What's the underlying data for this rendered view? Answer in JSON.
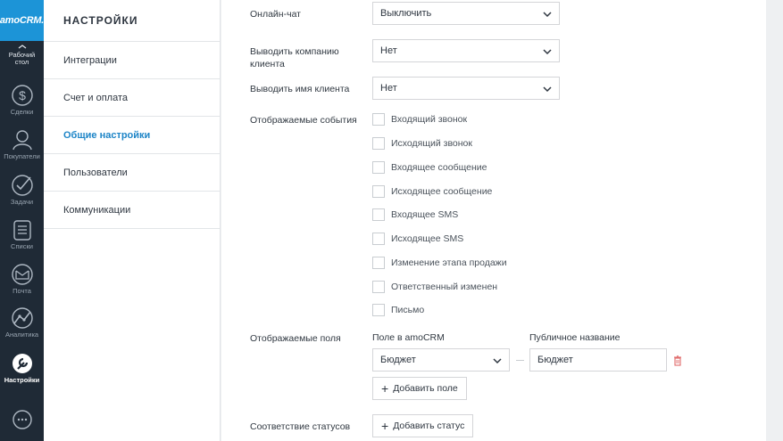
{
  "rail": {
    "logo": "amoCRM.",
    "items": [
      {
        "label": "Рабочий стол",
        "icon": "dashboard-icon"
      },
      {
        "label": "Сделки",
        "icon": "deals-icon"
      },
      {
        "label": "Покупатели",
        "icon": "customers-icon"
      },
      {
        "label": "Задачи",
        "icon": "tasks-icon"
      },
      {
        "label": "Списки",
        "icon": "lists-icon"
      },
      {
        "label": "Почта",
        "icon": "mail-icon"
      },
      {
        "label": "Аналитика",
        "icon": "analytics-icon"
      },
      {
        "label": "Настройки",
        "icon": "settings-icon"
      },
      {
        "label": "",
        "icon": "chat-icon"
      }
    ]
  },
  "sidebar": {
    "title": "НАСТРОЙКИ",
    "items": [
      {
        "label": "Интеграции"
      },
      {
        "label": "Счет и оплата"
      },
      {
        "label": "Общие настройки"
      },
      {
        "label": "Пользователи"
      },
      {
        "label": "Коммуникации"
      }
    ]
  },
  "main": {
    "online_chat": {
      "label": "Онлайн-чат",
      "value": "Выключить"
    },
    "show_company": {
      "label": "Выводить компанию клиента",
      "value": "Нет"
    },
    "show_name": {
      "label": "Выводить имя клиента",
      "value": "Нет"
    },
    "events": {
      "label": "Отображаемые события",
      "options": [
        {
          "label": "Входящий звонок",
          "checked": false
        },
        {
          "label": "Исходящий звонок",
          "checked": false
        },
        {
          "label": "Входящее сообщение",
          "checked": false
        },
        {
          "label": "Исходящее сообщение",
          "checked": false
        },
        {
          "label": "Входящее SMS",
          "checked": false
        },
        {
          "label": "Исходящее SMS",
          "checked": false
        },
        {
          "label": "Изменение этапа продажи",
          "checked": false
        },
        {
          "label": "Ответственный изменен",
          "checked": false
        },
        {
          "label": "Письмо",
          "checked": false
        }
      ]
    },
    "fields": {
      "label": "Отображаемые поля",
      "col_field": "Поле в amoCRM",
      "col_public": "Публичное название",
      "field_value": "Бюджет",
      "public_value": "Бюджет",
      "add_button": "Добавить поле"
    },
    "statuses": {
      "label": "Соответствие статусов",
      "add_button": "Добавить статус"
    }
  },
  "colors": {
    "rail_bg": "#1f2a36",
    "logo_bg": "#1c94d7",
    "active_link": "#1e85c7",
    "trash": "#e06a6a"
  }
}
